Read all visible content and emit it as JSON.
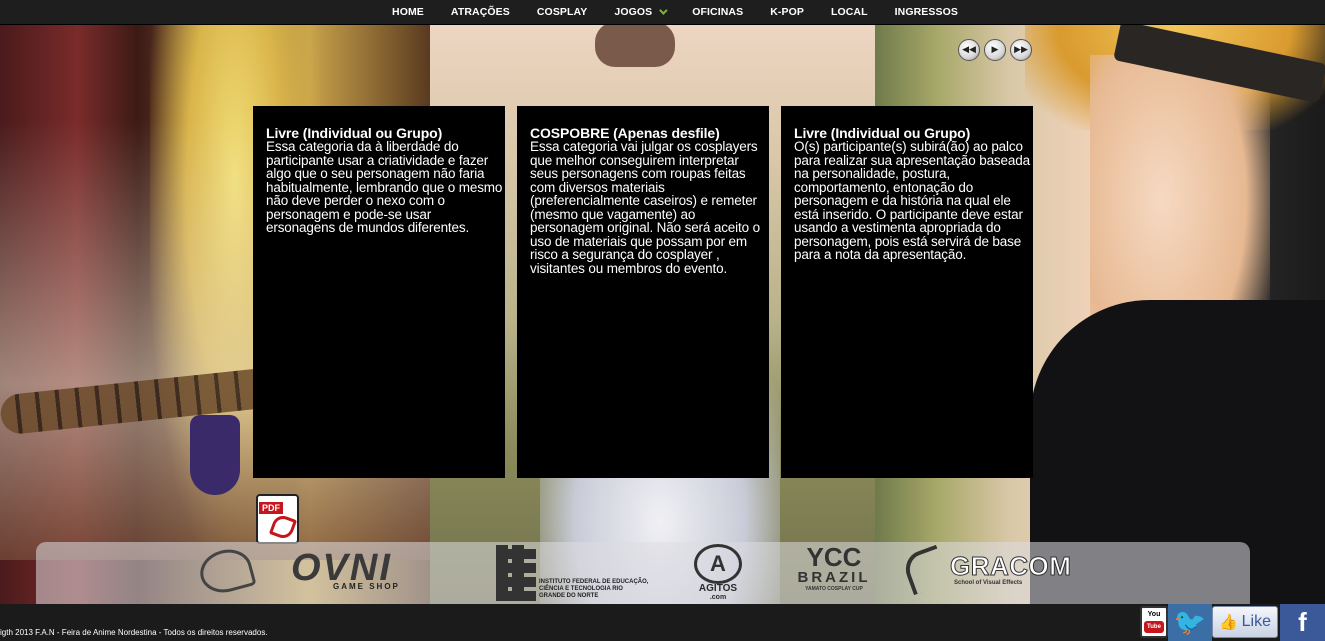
{
  "nav": {
    "items": [
      {
        "label": "HOME"
      },
      {
        "label": "ATRAÇÕES"
      },
      {
        "label": "COSPLAY"
      },
      {
        "label": "JOGOS",
        "has_dropdown": true
      },
      {
        "label": "OFICINAS"
      },
      {
        "label": "K-POP"
      },
      {
        "label": "LOCAL"
      },
      {
        "label": "INGRESSOS"
      }
    ],
    "accent_color": "#7ab33a"
  },
  "slider": {
    "controls": [
      {
        "icon": "rewind-icon",
        "glyph": "◀◀"
      },
      {
        "icon": "play-icon",
        "glyph": "▶"
      },
      {
        "icon": "fast-forward-icon",
        "glyph": "▶▶"
      }
    ]
  },
  "panels": [
    {
      "title": "Livre (Individual ou Grupo)",
      "body": "Essa categoria da à liberdade do participante usar a criatividade e fazer algo que o seu personagem não faria habitualmente, lembrando que o mesmo não deve perder o nexo com o personagem e pode-se usar ersonagens de mundos diferentes."
    },
    {
      "title": "COSPOBRE (Apenas desfile)",
      "body": "Essa categoria vai julgar os cosplayers que melhor conseguirem interpretar seus personagens com roupas feitas com diversos materiais (preferencialmente caseiros) e remeter (mesmo que vagamente) ao personagem original. Não será aceito o uso de materiais que possam por em risco a segurança do cosplayer , visitantes ou membros do evento."
    },
    {
      "title": "Livre (Individual ou Grupo)",
      "body": "O(s) participante(s) subirá(ão) ao palco para realizar sua apresentação baseada na personalidade, postura, comportamento, entonação do personagem e da história na qual ele está inserido. O participante deve estar usando a vestimenta apropriada do personagem, pois está servirá de base para a nota da apresentação."
    }
  ],
  "pdf": {
    "tag": "PDF"
  },
  "sponsors": {
    "ovni": {
      "name": "OVNI",
      "sub": "GAME SHOP"
    },
    "ifrn": {
      "text": "INSTITUTO FEDERAL DE EDUCAÇÃO, CIÊNCIA E TECNOLOGIA RIO GRANDE DO NORTE"
    },
    "agitos": {
      "mark": "A",
      "name": "AGITOS",
      "domain": ".com"
    },
    "ycc": {
      "mark": "YCC",
      "name": "BRAZIL",
      "sub": "YAMATO COSPLAY CUP"
    },
    "gracom": {
      "name": "GRACOM",
      "sub": "School of Visual Effects"
    }
  },
  "footer": {
    "copyright": "igth 2013 F.A.N - Feira de Anime Nordestina - Todos os direitos reservados.",
    "youtube": {
      "you": "You",
      "tube": "Tube"
    },
    "like_label": "Like",
    "facebook_glyph": "f",
    "twitter_glyph": "🐦"
  }
}
